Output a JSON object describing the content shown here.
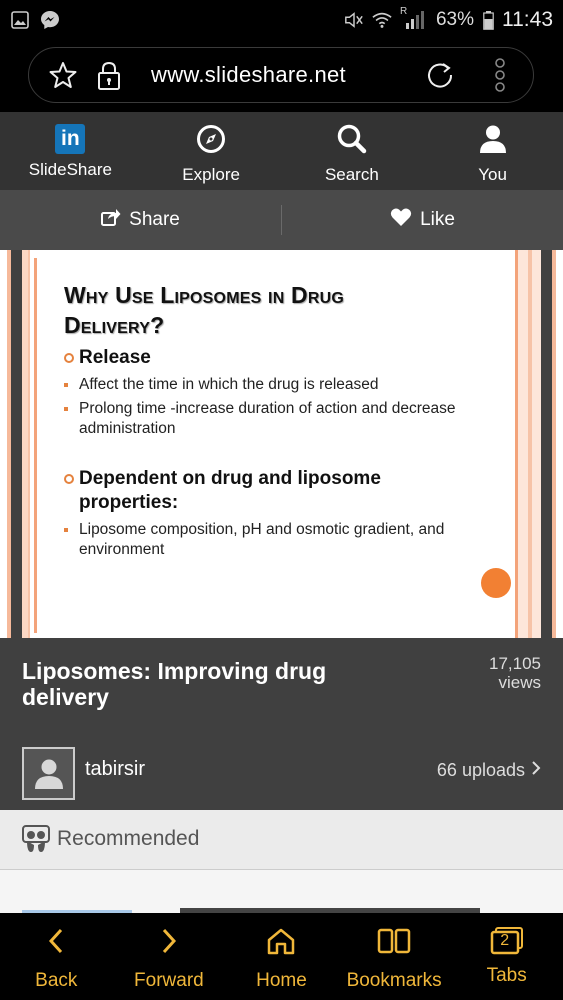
{
  "status_bar": {
    "battery": "63%",
    "time": "11:43",
    "signal_label": "R"
  },
  "browser": {
    "url": "www.slideshare.net"
  },
  "app_nav": {
    "items": [
      {
        "label": "SlideShare",
        "icon": "linkedin-icon"
      },
      {
        "label": "Explore",
        "icon": "compass-icon"
      },
      {
        "label": "Search",
        "icon": "search-icon"
      },
      {
        "label": "You",
        "icon": "user-icon"
      }
    ]
  },
  "actions": {
    "share": "Share",
    "like": "Like"
  },
  "slide": {
    "title_line1": "Why Use Liposomes in Drug",
    "title_line2": "Delivery?",
    "heading1": "Release",
    "bullet1": "Affect the time in which the drug is released",
    "bullet2": "Prolong time -increase duration of action and decrease administration",
    "heading2": "Dependent on drug and liposome properties:",
    "bullet3": "Liposome composition, pH and osmotic gradient, and environment"
  },
  "presentation": {
    "title": "Liposomes: Improving drug delivery",
    "views_count": "17,105",
    "views_label": "views"
  },
  "author": {
    "name": "tabirsir",
    "uploads": "66 uploads"
  },
  "recommended": {
    "label": "Recommended"
  },
  "bottom_nav": {
    "back": "Back",
    "forward": "Forward",
    "home": "Home",
    "bookmarks": "Bookmarks",
    "tabs": "Tabs",
    "tabs_count": "2"
  },
  "colors": {
    "accent": "#f0b73a",
    "linkedin_blue": "#1575b9",
    "slide_orange": "#e5823e"
  }
}
